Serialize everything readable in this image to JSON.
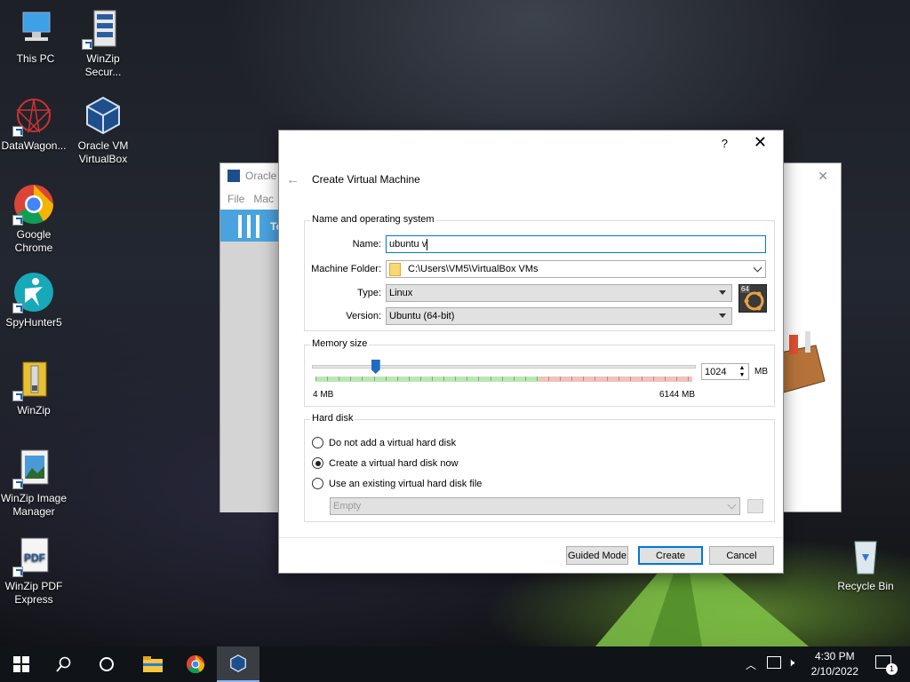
{
  "desktop": {
    "icons": [
      {
        "label": "This PC"
      },
      {
        "label": "WinZip Secur..."
      },
      {
        "label": "DataWagon..."
      },
      {
        "label": "Oracle VM VirtualBox"
      },
      {
        "label": "Google Chrome"
      },
      {
        "label": "SpyHunter5"
      },
      {
        "label": "WinZip"
      },
      {
        "label": "WinZip Image Manager"
      },
      {
        "label": "WinZip PDF Express"
      },
      {
        "label": "Recycle Bin"
      }
    ]
  },
  "bg_window": {
    "title": "Oracle",
    "menu": [
      "File",
      "Mac"
    ],
    "tools_label": "To"
  },
  "dialog": {
    "help": "?",
    "close": "✕",
    "back": "←",
    "title": "Create Virtual Machine",
    "name_os": {
      "group_title": "Name and operating system",
      "name_label": "Name:",
      "name_value": "ubuntu v",
      "folder_label": "Machine Folder:",
      "folder_value": "C:\\Users\\VM5\\VirtualBox VMs",
      "type_label": "Type:",
      "type_value": "Linux",
      "version_label": "Version:",
      "version_value": "Ubuntu (64-bit)",
      "os_badge": "64"
    },
    "memory": {
      "group_title": "Memory size",
      "value": "1024",
      "unit": "MB",
      "min_label": "4 MB",
      "max_label": "6144 MB",
      "slider_fraction": 0.166
    },
    "hard_disk": {
      "group_title": "Hard disk",
      "options": [
        {
          "label": "Do not add a virtual hard disk",
          "selected": false
        },
        {
          "label": "Create a virtual hard disk now",
          "selected": true
        },
        {
          "label": "Use an existing virtual hard disk file",
          "selected": false
        }
      ],
      "file_placeholder": "Empty"
    },
    "buttons": {
      "guided": "Guided Mode",
      "create": "Create",
      "cancel": "Cancel"
    }
  },
  "taskbar": {
    "time": "4:30 PM",
    "date": "2/10/2022",
    "notification_count": "1"
  },
  "colors": {
    "accent": "#0078d7",
    "slider_green": "#b8e8b0",
    "slider_red": "#f5c0b8",
    "slider_thumb": "#1e6bc4"
  }
}
